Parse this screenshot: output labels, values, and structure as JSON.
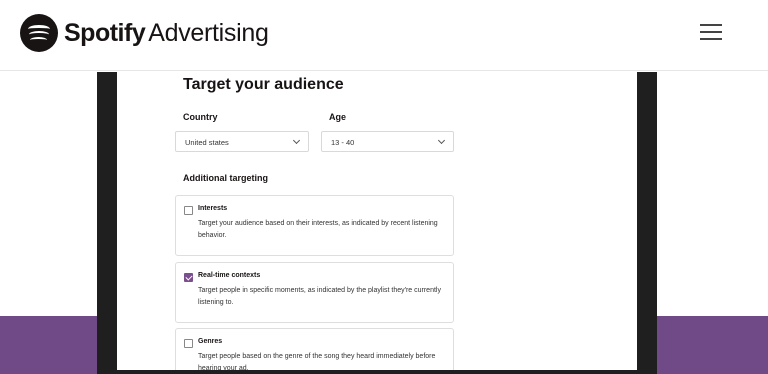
{
  "header": {
    "brand": "Spotify",
    "brand_sub": "Advertising",
    "logo_icon": "spotify-logo-icon",
    "menu_icon": "hamburger-menu-icon"
  },
  "form": {
    "title": "Target your audience",
    "country": {
      "label": "Country",
      "value": "United states"
    },
    "age": {
      "label": "Age",
      "value": "13 - 40"
    },
    "additional_label": "Additional targeting",
    "options": [
      {
        "title": "Interests",
        "description": "Target your audience based on their interests, as indicated by recent listening behavior.",
        "checked": false
      },
      {
        "title": "Real-time contexts",
        "description": "Target people in specific moments, as indicated by the playlist they're currently listening to.",
        "checked": true
      },
      {
        "title": "Genres",
        "description": "Target people based on the genre of the song they heard immediately before hearing your ad.",
        "checked": false
      }
    ]
  },
  "colors": {
    "band": "#6f4a86",
    "checkbox_checked": "#7b4f8e",
    "device_frame": "#1f1f1f"
  }
}
